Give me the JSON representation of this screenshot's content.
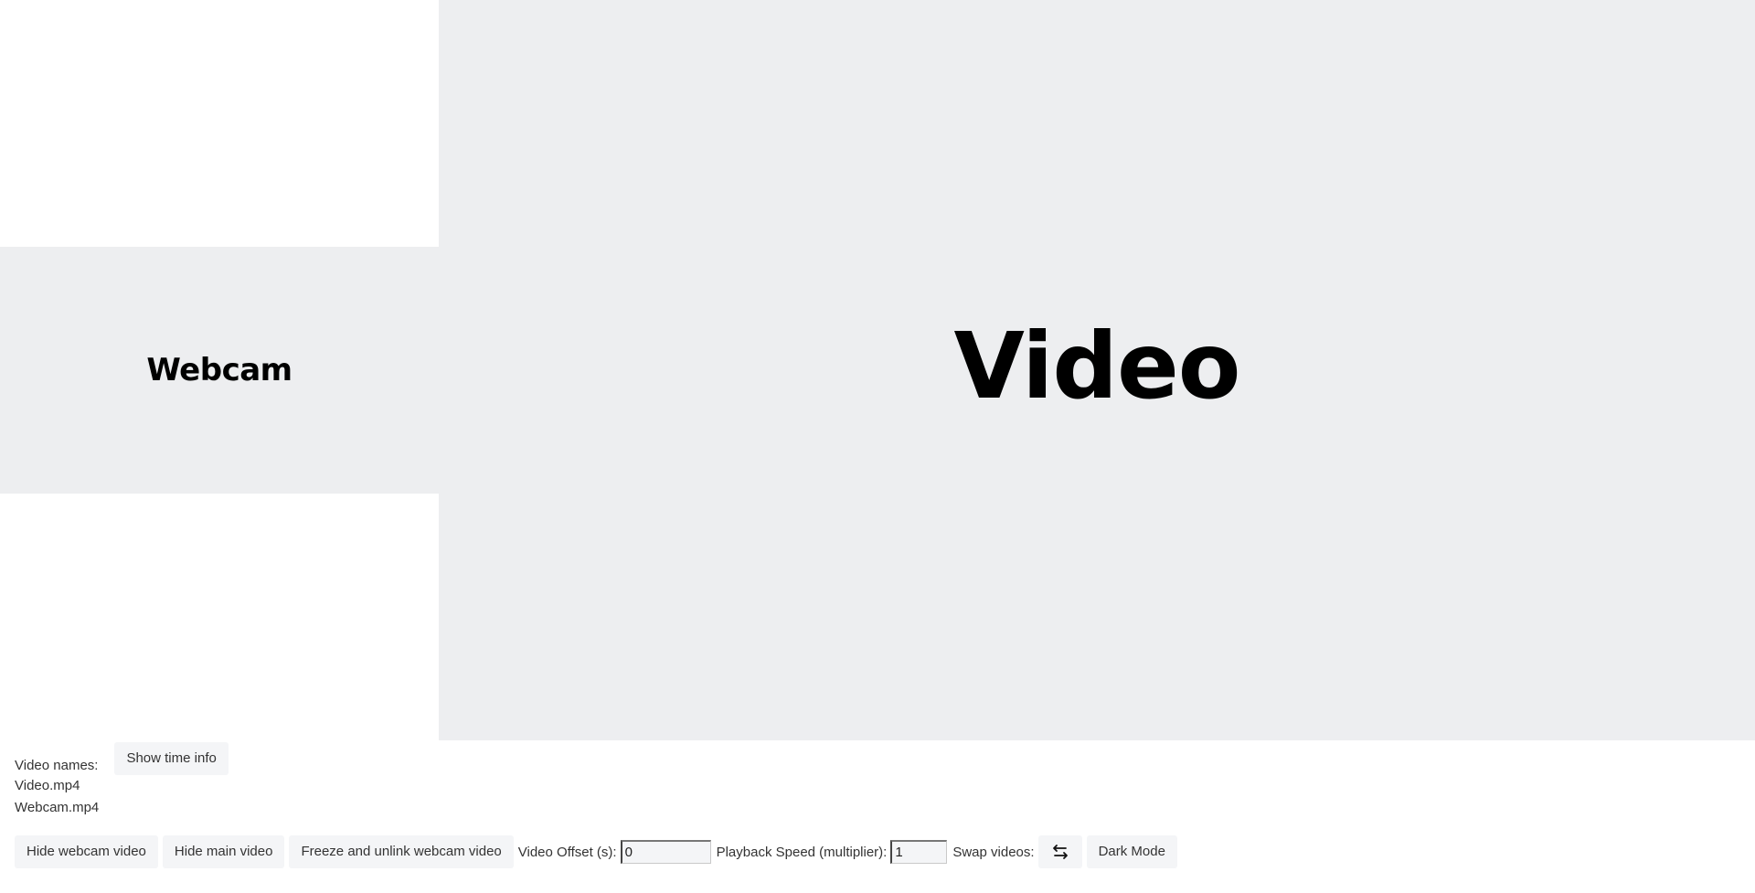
{
  "webcam_panel": {
    "label": "Webcam"
  },
  "video_panel": {
    "label": "Video"
  },
  "info": {
    "names_label": "Video names:",
    "show_time_info": "Show time info",
    "files": [
      "Video.mp4",
      "Webcam.mp4"
    ]
  },
  "controls": {
    "hide_webcam": "Hide webcam video",
    "hide_main": "Hide main video",
    "freeze_unlink": "Freeze and unlink webcam video",
    "offset_label": "Video Offset (s):",
    "offset_value": "0",
    "speed_label": "Playback Speed (multiplier):",
    "speed_value": "1",
    "swap_label": "Swap videos:",
    "swap_icon": "swap-arrows-icon",
    "dark_mode": "Dark Mode"
  },
  "colors": {
    "panel_bg": "#edeef0",
    "button_bg": "#f4f5f7"
  }
}
